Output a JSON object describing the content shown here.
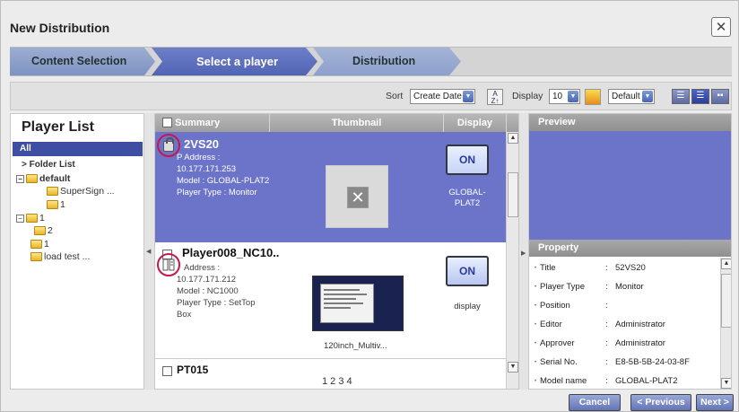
{
  "dialog": {
    "title": "New Distribution",
    "close_icon": "close-icon"
  },
  "steps": [
    "Content Selection",
    "Select a player",
    "Distribution"
  ],
  "toolbar": {
    "sort_label": "Sort",
    "sort_value": "Create Date",
    "display_label": "Display",
    "display_value": "10",
    "theme_value": "Default",
    "sort_direction_icon": "sort-az-icon",
    "thumbnail_view_icon": "thumbnail-icon",
    "view_icons": [
      "list-view-icon",
      "detail-view-icon",
      "grid-view-icon"
    ]
  },
  "player_list": {
    "title": "Player List",
    "all_label": "All",
    "folder_list_label": "> Folder List",
    "tree": [
      {
        "toggle": "⊟",
        "label": "default"
      },
      {
        "label": "SuperSign ..."
      },
      {
        "label": "1"
      },
      {
        "toggle": "⊟",
        "label": "1"
      },
      {
        "label": "2"
      },
      {
        "label": "1"
      },
      {
        "label": "load test ..."
      }
    ]
  },
  "list": {
    "columns": [
      "Summary",
      "Thumbnail",
      "Display"
    ],
    "rows": [
      {
        "name": "52VS20",
        "name_shown": "2VS20",
        "info": [
          "IP Address :",
          "10.177.171.253",
          "Model : GLOBAL-PLAT2",
          "Player Type : Monitor"
        ],
        "info_shown": [
          "P Address :",
          "10.177.171.253",
          "Model : GLOBAL-PLAT2",
          "Player Type : Monitor"
        ],
        "status_icon": "lock-icon",
        "display_button": "ON",
        "display_text": "GLOBAL-PLAT2",
        "thumbnail_icon": "no-image-icon"
      },
      {
        "name_shown": "Player008_NC10..",
        "info_shown": [
          "Address :",
          "10.177.171.212",
          "Model : NC1000",
          "Player Type : SetTop",
          "Box"
        ],
        "status_icon": "device-icon",
        "display_button": "ON",
        "display_text": "display",
        "thumbnail_caption": "120inch_Multiv..."
      },
      {
        "name_shown": "PT015"
      }
    ],
    "pager": "1 2 3 4"
  },
  "right_panel": {
    "preview_label": "Preview",
    "property_label": "Property",
    "properties": [
      {
        "key": "Title",
        "value": "52VS20"
      },
      {
        "key": "Player Type",
        "value": "Monitor"
      },
      {
        "key": "Position",
        "value": ""
      },
      {
        "key": "Editor",
        "value": "Administrator"
      },
      {
        "key": "Approver",
        "value": "Administrator"
      },
      {
        "key": "Serial No.",
        "value": "E8-5B-5B-24-03-8F"
      },
      {
        "key": "Model name",
        "value": "GLOBAL-PLAT2"
      }
    ]
  },
  "footer": {
    "cancel": "Cancel",
    "previous": "< Previous",
    "next": "Next >"
  }
}
